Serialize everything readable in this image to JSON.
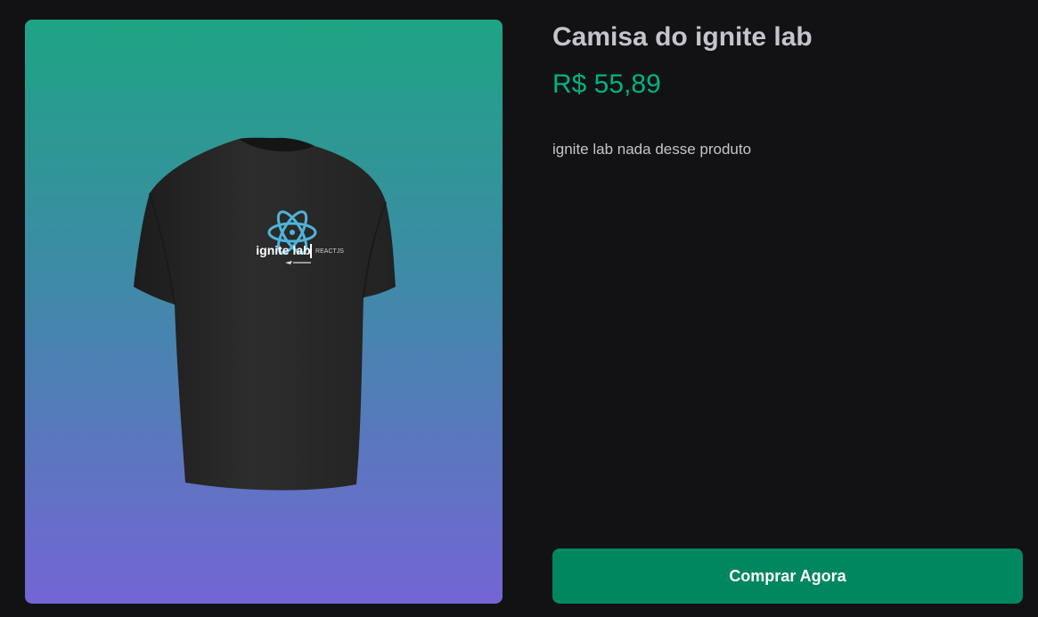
{
  "product": {
    "title": "Camisa do ignite lab",
    "price": "R$ 55,89",
    "description": "ignite lab nada desse produto",
    "image": {
      "icon": "tshirt-image",
      "shirt_print_brand": "ignite lab",
      "shirt_print_tag": "REACTJS",
      "shirt_color": "#2a2a2a",
      "logo_color": "#4fb3d9"
    },
    "buy_label": "Comprar Agora"
  },
  "colors": {
    "background": "#121214",
    "title": "#c4c4cc",
    "price": "#00b37e",
    "button": "#00875f",
    "gradient_top": "#1ea483",
    "gradient_bottom": "#7465d4"
  }
}
